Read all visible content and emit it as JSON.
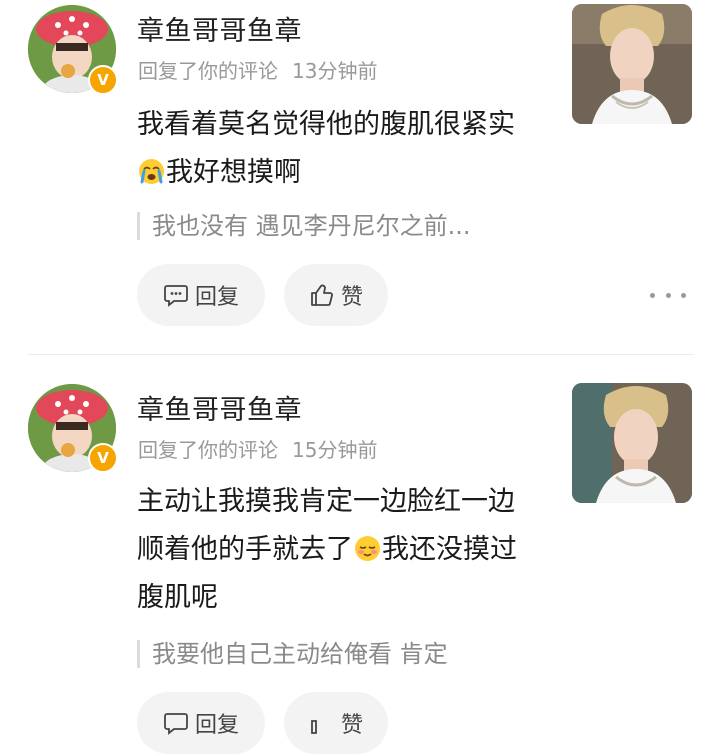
{
  "notices": [
    {
      "username": "章鱼哥哥鱼章",
      "action": "回复了你的评论",
      "time": "13分钟前",
      "text_before_emoji": "我看着莫名觉得他的腹肌很紧实",
      "emoji": "crying-face-emoji",
      "text_after_emoji": "我好想摸啊",
      "quote": "我也没有 遇见李丹尼尔之前...",
      "reply_label": "回复",
      "like_label": "赞"
    },
    {
      "username": "章鱼哥哥鱼章",
      "action": "回复了你的评论",
      "time": "15分钟前",
      "text_before_emoji": "主动让我摸我肯定一边脸红一边顺着他的手就去了",
      "emoji": "blushing-face-emoji",
      "text_after_emoji": "我还没摸过腹肌呢",
      "quote": "我要他自己主动给俺看 肯定",
      "reply_label": "回复",
      "like_label": "赞"
    }
  ],
  "icons": {
    "verified": "verified-v-badge-icon",
    "reply": "comment-bubble-icon",
    "like": "thumbs-up-icon",
    "more": "more-dots-icon"
  },
  "colors": {
    "verified_badge": "#f6a400",
    "meta_text": "#999999",
    "pill_bg": "#f3f3f3"
  },
  "badge_letter": "V"
}
